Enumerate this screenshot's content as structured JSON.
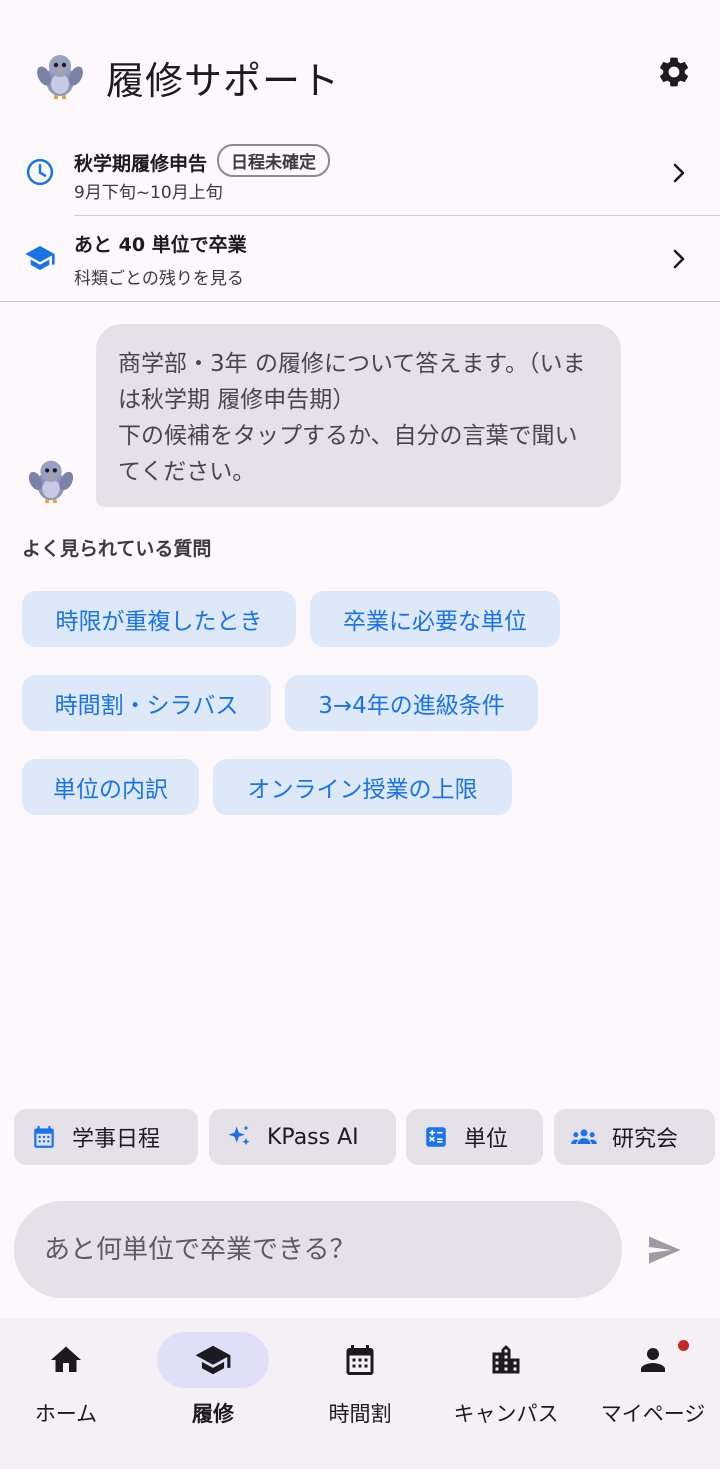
{
  "header": {
    "title": "履修サポート"
  },
  "info_rows": [
    {
      "title": "秋学期履修申告",
      "badge": "日程未確定",
      "subtitle": "9月下旬~10月上旬"
    },
    {
      "title": "あと 40 単位で卒業",
      "subtitle": "科類ごとの残りを見る"
    }
  ],
  "chat": {
    "bot_message": "商学部・3年 の履修について答えます。（いまは秋学期 履修申告期）\n下の候補をタップするか、自分の言葉で聞いてください。"
  },
  "suggestions": {
    "label": "よく見られている質問",
    "chips": [
      "時限が重複したとき",
      "卒業に必要な単位",
      "時間割・シラバス",
      "3→4年の進級条件",
      "単位の内訳",
      "オンライン授業の上限"
    ]
  },
  "shortcuts": [
    {
      "label": "学事日程",
      "icon": "calendar-icon"
    },
    {
      "label": "KPass AI",
      "icon": "sparkle-icon"
    },
    {
      "label": "単位",
      "icon": "calculator-icon"
    },
    {
      "label": "研究会",
      "icon": "groups-icon"
    }
  ],
  "input": {
    "placeholder": "あと何単位で卒業できる？"
  },
  "bottom_nav": {
    "items": [
      {
        "label": "ホーム",
        "icon": "home-icon"
      },
      {
        "label": "履修",
        "icon": "school-icon"
      },
      {
        "label": "時間割",
        "icon": "calendar-grid-icon"
      },
      {
        "label": "キャンパス",
        "icon": "building-icon"
      },
      {
        "label": "マイページ",
        "icon": "person-icon"
      }
    ],
    "active_index": 1
  },
  "colors": {
    "accent": "#1a73e8",
    "chip_bg": "#dde8f9",
    "surface": "#fcf8fc",
    "bubble": "#e4e1e9",
    "nav_active": "#dfdff6",
    "notification": "#c62828"
  }
}
